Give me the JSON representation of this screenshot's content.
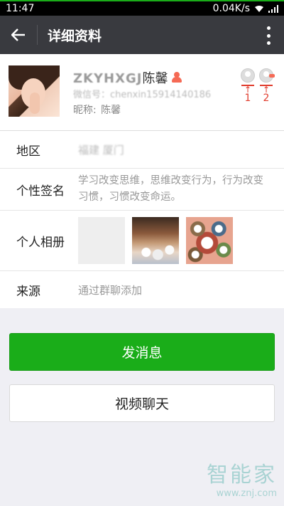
{
  "status": {
    "time": "11:47",
    "speed": "0.04K/s"
  },
  "appbar": {
    "title": "详细资料"
  },
  "profile": {
    "nickname_blurred": "ZKYHXGJ",
    "nickname": "陈馨",
    "wechat_id": "微信号：chenxin15914140186",
    "remark_label": "昵称:",
    "remark_value": "陈馨",
    "annotations": [
      "1",
      "2"
    ]
  },
  "rows": {
    "region_label": "地区",
    "region_value": "福建  厦门",
    "signature_label": "个性签名",
    "signature_value": "学习改变思维，思维改变行为，行为改变习惯，习惯改变命运。",
    "album_label": "个人相册",
    "source_label": "来源",
    "source_value": "通过群聊添加"
  },
  "buttons": {
    "send_message": "发消息",
    "video_chat": "视频聊天"
  },
  "watermark": {
    "brand": "智能家",
    "url": "www.znj.com"
  },
  "colors": {
    "accent": "#1aad19",
    "appbar": "#393a3f",
    "annotation": "#e03c2d"
  }
}
